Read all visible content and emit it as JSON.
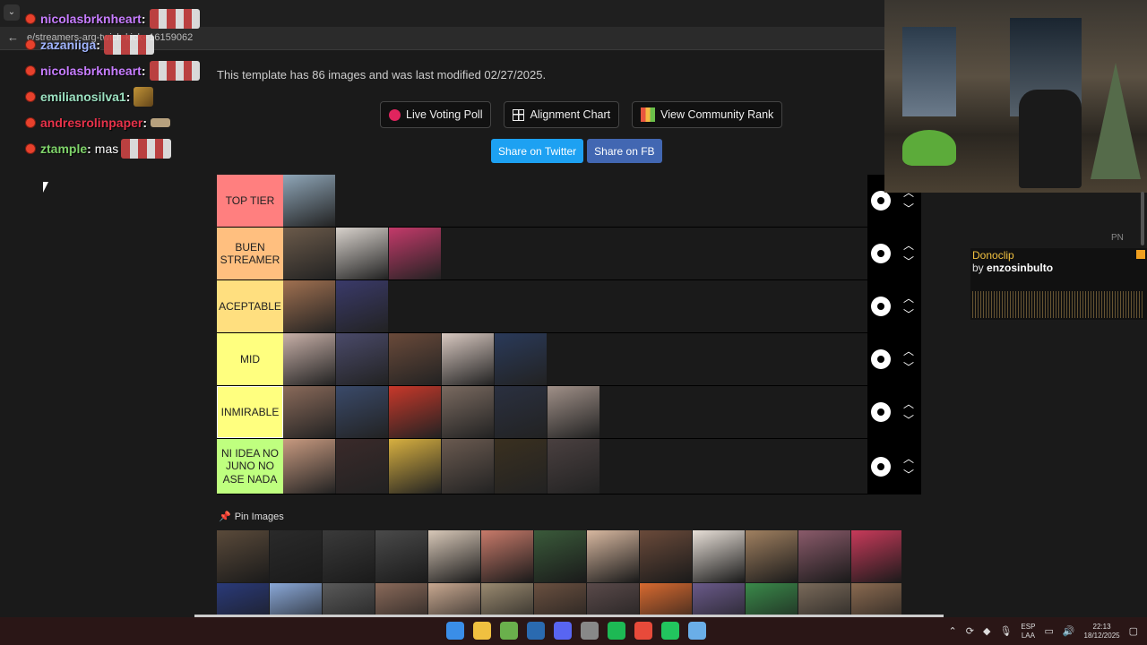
{
  "browser": {
    "url": "e/streamers-arg-twich-kick--16159062",
    "menu_glyph": "⌄",
    "back_glyph": "←"
  },
  "chat": [
    {
      "user": "nicolasbrknheart",
      "color": "#c77dff",
      "msg": ""
    },
    {
      "user": "zazaniiga",
      "color": "#a0b4ff",
      "msg": ""
    },
    {
      "user": "nicolasbrknheart",
      "color": "#c77dff",
      "msg": ""
    },
    {
      "user": "emilianosilva1",
      "color": "#9be0c0",
      "msg": ""
    },
    {
      "user": "andresrolinpaper",
      "color": "#e8324a",
      "msg": ""
    },
    {
      "user": "ztample",
      "color": "#7fd36a",
      "msg": "mas"
    }
  ],
  "page": {
    "info": "This template has 86 images and was last modified 02/27/2025.",
    "buttons": {
      "voting": "Live Voting Poll",
      "alignment": "Alignment Chart",
      "community": "View Community Rank"
    },
    "share": {
      "twitter": "Share on Twitter",
      "fb": "Share on FB"
    },
    "pin_label": "Pin Images"
  },
  "tiers": [
    {
      "label": "TOP TIER",
      "color": "#ff7f7f",
      "height": 59,
      "images": [
        "#8fa6b8"
      ]
    },
    {
      "label": "BUEN STREAMER",
      "color": "#ffbf7f",
      "height": 59,
      "images": [
        "#6b5a4a",
        "#d8d2cc",
        "#c43a6a"
      ]
    },
    {
      "label": "ACEPTABLE",
      "color": "#ffdf7f",
      "height": 59,
      "images": [
        "#a07050",
        "#3a3a6a"
      ]
    },
    {
      "label": "MID",
      "color": "#ffff7f",
      "height": 59,
      "images": [
        "#c8b0a8",
        "#4a4a6a",
        "#6a4a3a",
        "#d8c8c0",
        "#2a3a5a"
      ]
    },
    {
      "label": "INMIRABLE",
      "color": "#ffff7f",
      "height": 59,
      "images": [
        "#8a6a5a",
        "#3a4a6a",
        "#c8382a",
        "#7a6a60",
        "#2a3040",
        "#a09088"
      ]
    },
    {
      "label": "NI IDEA NO JUNO NO ASE NADA",
      "color": "#bfff7f",
      "height": 62,
      "images": [
        "#c89a80",
        "#3a2a2a",
        "#d8b040",
        "#6a5a50",
        "#3a3020",
        "#4a4040"
      ]
    }
  ],
  "pool_images": [
    "#5a4a3a",
    "#2a2a2a",
    "#3a3a3a",
    "#4a4a4a",
    "#d8c8b8",
    "#c87a6a",
    "#3a5a3a",
    "#d8b8a0",
    "#6a4a3a",
    "#e8e0d8",
    "#a08060",
    "#8a5a6a",
    "#c83a5a",
    "#2a3a7a",
    "#8aa8d8",
    "#5a5a5a",
    "#8a6a5a",
    "#c8a890",
    "#9a8a70",
    "#6a5040",
    "#5a4a4a",
    "#d86a30",
    "#6a5a8a",
    "#3a8a4a",
    "#7a6a5a",
    "#8a6a50"
  ],
  "donoclip": {
    "title": "Donoclip",
    "by": "by",
    "user": "enzosinbulto"
  },
  "pn": "PN",
  "taskbar": {
    "icon_colors": [
      "#3a8ee8",
      "#f0c040",
      "#6ab04c",
      "#2a6ab0",
      "#5865f2",
      "#888888",
      "#1db954",
      "#e84a3a",
      "#22c55e",
      "#6aaee8"
    ],
    "lang1": "ESP",
    "lang2": "LAA",
    "time": "22:13",
    "date": "18/12/2025"
  }
}
